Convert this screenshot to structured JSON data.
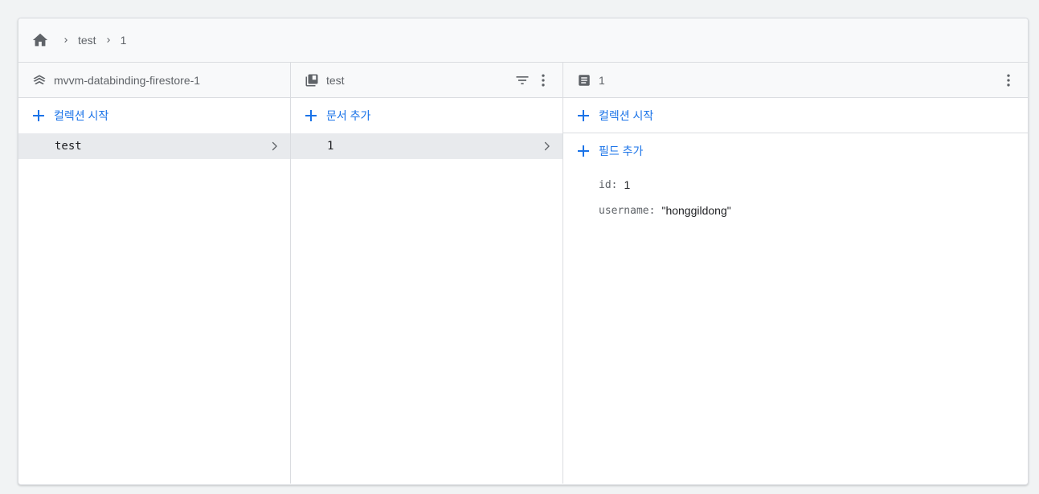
{
  "breadcrumb": {
    "home_icon": "home-icon",
    "items": [
      "test",
      "1"
    ]
  },
  "panels": {
    "root": {
      "title": "mvvm-databinding-firestore-1",
      "icon": "firestore-stack-icon",
      "action_label": "컬렉션 시작",
      "items": [
        {
          "label": "test"
        }
      ]
    },
    "collection": {
      "title": "test",
      "icon": "collection-icon",
      "action_label": "문서 추가",
      "items": [
        {
          "label": "1"
        }
      ]
    },
    "document": {
      "title": "1",
      "icon": "document-icon",
      "start_collection_label": "컬렉션 시작",
      "add_field_label": "필드 추가",
      "fields": [
        {
          "key": "id",
          "value": "1",
          "type": "number"
        },
        {
          "key": "username",
          "value": "honggildong",
          "type": "string"
        }
      ]
    }
  },
  "colors": {
    "accent": "#1a73e8",
    "selected_row": "#e8eaed",
    "header_bg": "#f8f9fa",
    "border": "#dadce0"
  }
}
